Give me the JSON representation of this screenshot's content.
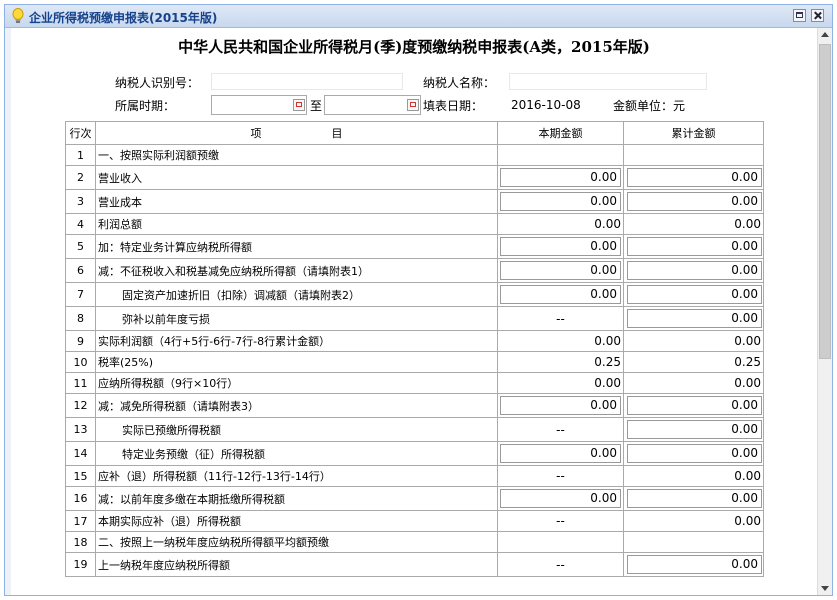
{
  "window": {
    "title": "企业所得税预缴申报表(2015年版)"
  },
  "report": {
    "title": "中华人民共和国企业所得税月(季)度预缴纳税申报表(A类，2015年版)",
    "taxpayer_id_label": "纳税人识别号：",
    "taxpayer_id_value": "",
    "taxpayer_name_label": "纳税人名称：",
    "taxpayer_name_value": "",
    "period_label": "所属时期：",
    "period_start": "",
    "period_to": "至",
    "period_end": "",
    "fill_date_label": "填表日期：",
    "fill_date_value": "2016-10-08",
    "unit_label": "金额单位：元"
  },
  "table": {
    "headers": {
      "no": "行次",
      "item": "项                    目",
      "current": "本期金额",
      "cumulative": "累计金额"
    },
    "rows": [
      {
        "no": "1",
        "item": "一、按照实际利润额预缴",
        "current": "",
        "cumulative": ""
      },
      {
        "no": "2",
        "item": "营业收入",
        "current": "0.00",
        "cumulative": "0.00"
      },
      {
        "no": "3",
        "item": "营业成本",
        "current": "0.00",
        "cumulative": "0.00"
      },
      {
        "no": "4",
        "item": "利润总额",
        "current": "0.00",
        "cumulative": "0.00"
      },
      {
        "no": "5",
        "item": "加：特定业务计算应纳税所得额",
        "current": "0.00",
        "cumulative": "0.00"
      },
      {
        "no": "6",
        "item": "减：不征税收入和税基减免应纳税所得额（请填附表1）",
        "current": "0.00",
        "cumulative": "0.00"
      },
      {
        "no": "7",
        "item": "固定资产加速折旧（扣除）调减额（请填附表2）",
        "current": "0.00",
        "cumulative": "0.00"
      },
      {
        "no": "8",
        "item": "弥补以前年度亏损",
        "current": "--",
        "cumulative": "0.00"
      },
      {
        "no": "9",
        "item": "实际利润额（4行+5行-6行-7行-8行累计金额）",
        "current": "0.00",
        "cumulative": "0.00"
      },
      {
        "no": "10",
        "item": "税率(25%)",
        "current": "0.25",
        "cumulative": "0.25"
      },
      {
        "no": "11",
        "item": "应纳所得税额（9行×10行）",
        "current": "0.00",
        "cumulative": "0.00"
      },
      {
        "no": "12",
        "item": "减：减免所得税额（请填附表3）",
        "current": "0.00",
        "cumulative": "0.00"
      },
      {
        "no": "13",
        "item": "实际已预缴所得税额",
        "current": "--",
        "cumulative": "0.00"
      },
      {
        "no": "14",
        "item": "特定业务预缴（征）所得税额",
        "current": "0.00",
        "cumulative": "0.00"
      },
      {
        "no": "15",
        "item": "应补（退）所得税额（11行-12行-13行-14行）",
        "current": "--",
        "cumulative": "0.00"
      },
      {
        "no": "16",
        "item": "减：以前年度多缴在本期抵缴所得税额",
        "current": "0.00",
        "cumulative": "0.00"
      },
      {
        "no": "17",
        "item": "本期实际应补（退）所得税额",
        "current": "--",
        "cumulative": "0.00"
      },
      {
        "no": "18",
        "item": "二、按照上一纳税年度应纳税所得额平均额预缴",
        "current": "",
        "cumulative": ""
      },
      {
        "no": "19",
        "item": "上一纳税年度应纳税所得额",
        "current": "--",
        "cumulative": "0.00"
      }
    ]
  },
  "icons": {
    "title_icon": "lightbulb-icon",
    "restore_icon": "window-restore-icon",
    "close_icon": "window-close-icon",
    "calendar_icon": "calendar-icon"
  },
  "colors": {
    "titlebar_text": "#15428b",
    "border": "#8db2e3"
  }
}
